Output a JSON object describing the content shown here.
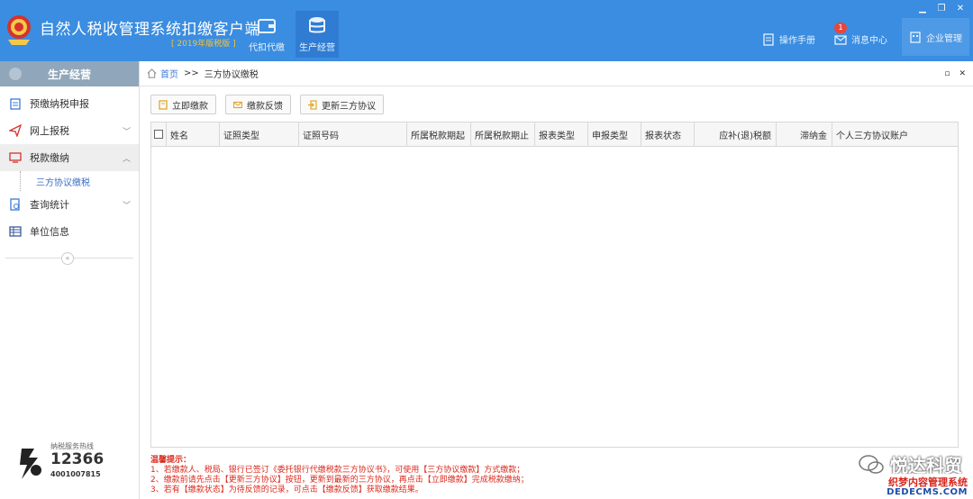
{
  "colors": {
    "header": "#3a8de0",
    "accent": "#3a7bd5",
    "tips": "#d92b1e",
    "sidebar_head": "#8fa6bb"
  },
  "header": {
    "title": "自然人税收管理系统扣缴客户端",
    "version": "[ 2019年版税版 ]",
    "tabs": [
      {
        "label": "代扣代缴",
        "icon": "wallet-icon"
      },
      {
        "label": "生产经营",
        "icon": "coins-icon"
      }
    ],
    "right": {
      "manual": "操作手册",
      "messages": "消息中心",
      "message_count": "1",
      "enterprise": "企业管理"
    }
  },
  "sidebar": {
    "title": "生产经营",
    "items": [
      {
        "label": "预缴纳税申报",
        "icon": "clipboard-icon"
      },
      {
        "label": "网上报税",
        "icon": "send-icon"
      },
      {
        "label": "税款缴纳",
        "icon": "monitor-icon"
      },
      {
        "label": "查询统计",
        "icon": "search-doc-icon"
      },
      {
        "label": "单位信息",
        "icon": "table-icon"
      }
    ],
    "sub_item": "三方协议缴税",
    "collapse": "«",
    "hotline": {
      "label": "纳税服务热线",
      "number": "12366",
      "number2": "4001007815"
    }
  },
  "breadcrumb": {
    "home": "首页",
    "sep": ">>",
    "current": "三方协议缴税"
  },
  "toolbar": {
    "pay_now": "立即缴款",
    "feedback": "缴款反馈",
    "update_agreement": "更新三方协议"
  },
  "grid": {
    "columns": [
      "姓名",
      "证照类型",
      "证照号码",
      "所属税款期起",
      "所属税款期止",
      "报表类型",
      "申报类型",
      "报表状态",
      "应补(退)税额",
      "滞纳金",
      "个人三方协议账户"
    ]
  },
  "tips": {
    "title": "温馨提示：",
    "lines": [
      "1、若缴款人、税局、银行已签订《委托银行代缴税款三方协议书》，可使用【三方协议缴款】方式缴款；",
      "2、缴款前请先点击【更新三方协议】按钮，更新到最新的三方协议，再点击【立即缴款】完成税款缴纳；",
      "3、若有【缴款状态】为待反馈的记录，可点击【缴款反馈】获取缴款结果。"
    ]
  },
  "watermark": {
    "brand": "悦达科贸",
    "site": "织梦内容管理系统",
    "domain": "DEDECMS.COM"
  }
}
